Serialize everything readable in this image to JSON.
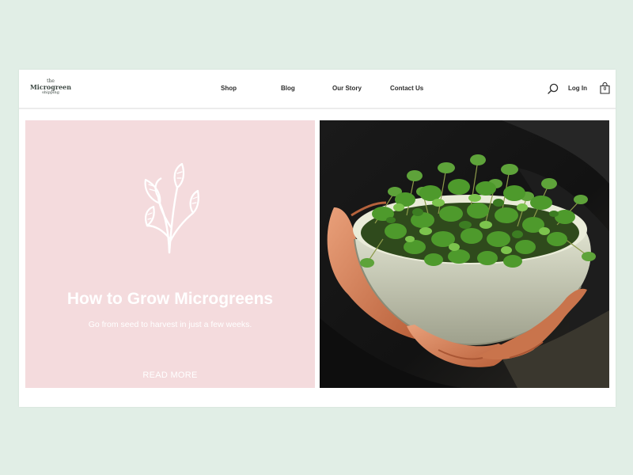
{
  "logo": {
    "top": "the",
    "main": "Microgreen",
    "bottom": "shipping"
  },
  "nav": {
    "items": [
      {
        "label": "Shop"
      },
      {
        "label": "Blog"
      },
      {
        "label": "Our Story"
      },
      {
        "label": "Contact Us"
      }
    ]
  },
  "header": {
    "search_icon": "search-icon",
    "login_label": "Log In",
    "cart_icon": "shopping-bag-icon",
    "cart_count": "0"
  },
  "promo": {
    "title": "How to Grow Microgreens",
    "subtitle": "Go from seed to harvest in just a few weeks.",
    "cta": "READ MORE",
    "icon": "sprout-icon",
    "background_color": "#f4dbdd"
  },
  "photo": {
    "subject": "hands-holding-bowl-of-microgreens"
  },
  "colors": {
    "page_background": "#e1eee6",
    "frame": "#ffffff",
    "text_dark": "#2e2e2e",
    "leaf_green": "#4e9a2c"
  }
}
